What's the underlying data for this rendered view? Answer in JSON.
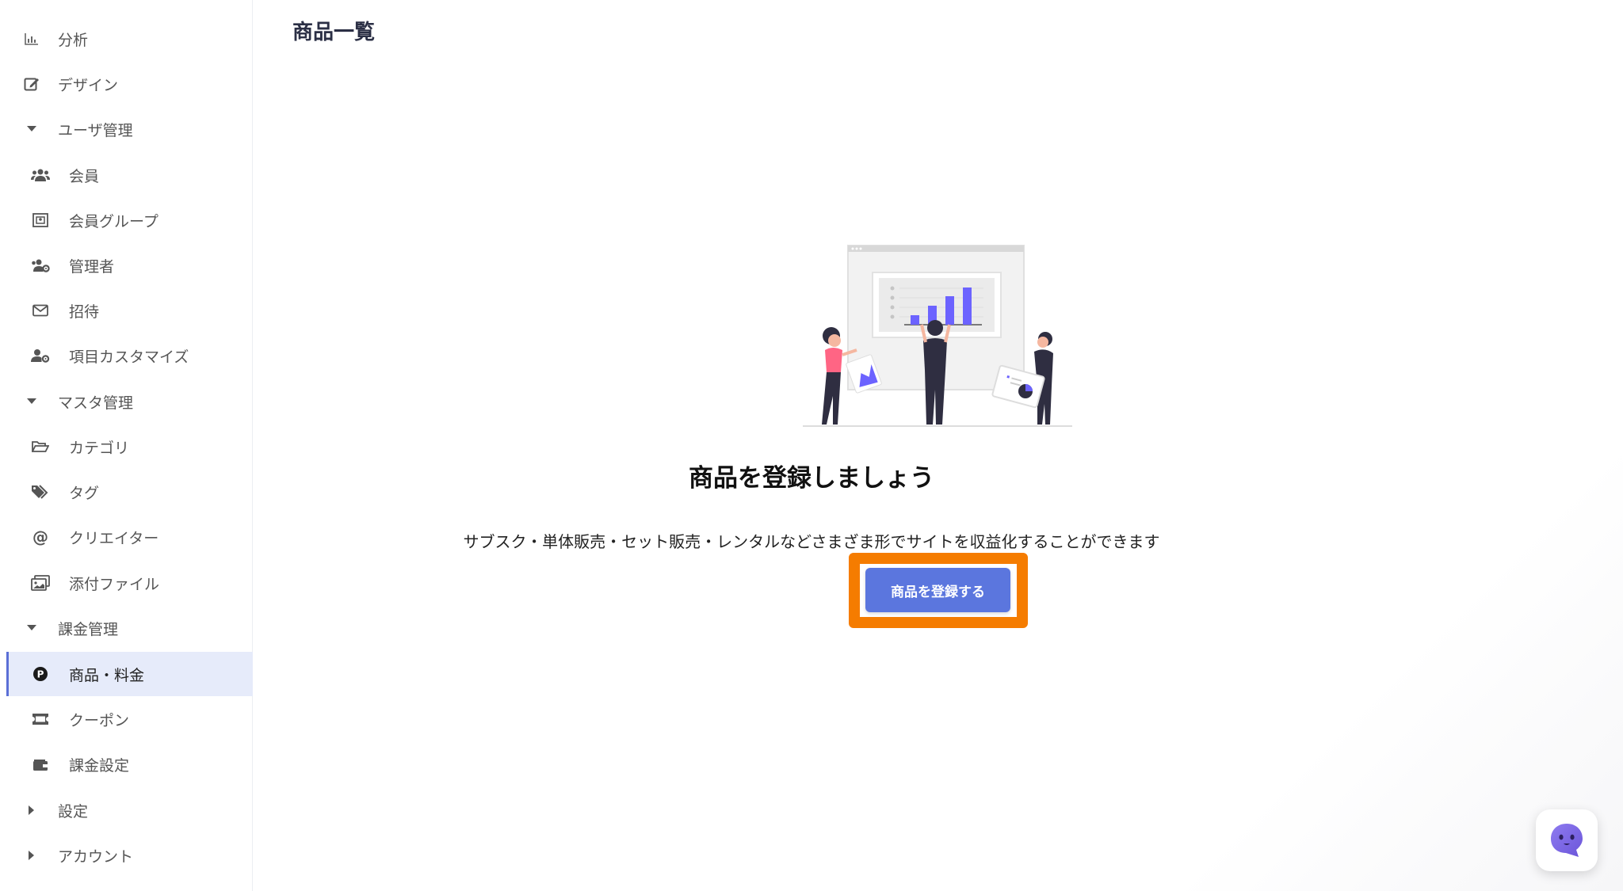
{
  "page": {
    "title": "商品一覧"
  },
  "sidebar": {
    "items": [
      {
        "label": "分析",
        "icon": "chart-bar-icon"
      },
      {
        "label": "デザイン",
        "icon": "edit-icon"
      },
      {
        "label": "ユーザ管理",
        "icon": "caret-down-icon"
      },
      {
        "label": "会員",
        "icon": "users-icon"
      },
      {
        "label": "会員グループ",
        "icon": "group-icon"
      },
      {
        "label": "管理者",
        "icon": "users-gear-icon"
      },
      {
        "label": "招待",
        "icon": "mail-icon"
      },
      {
        "label": "項目カスタマイズ",
        "icon": "user-gear-icon"
      },
      {
        "label": "マスタ管理",
        "icon": "caret-down-icon"
      },
      {
        "label": "カテゴリ",
        "icon": "folder-icon"
      },
      {
        "label": "タグ",
        "icon": "tags-icon"
      },
      {
        "label": "クリエイター",
        "icon": "at-icon"
      },
      {
        "label": "添付ファイル",
        "icon": "images-icon"
      },
      {
        "label": "課金管理",
        "icon": "caret-down-icon"
      },
      {
        "label": "商品・料金",
        "icon": "product-p-icon",
        "active": true
      },
      {
        "label": "クーポン",
        "icon": "ticket-icon"
      },
      {
        "label": "課金設定",
        "icon": "wallet-icon"
      },
      {
        "label": "設定",
        "icon": "caret-right-icon"
      },
      {
        "label": "アカウント",
        "icon": "caret-right-icon"
      }
    ]
  },
  "empty_state": {
    "title": "商品を登録しましょう",
    "description": "サブスク・単体販売・セット販売・レンタルなどさまざま形でサイトを収益化することができます",
    "button_label": "商品を登録する"
  },
  "colors": {
    "accent": "#5b76de",
    "highlight": "#f57c00",
    "active_bg": "#e6ebfa"
  }
}
